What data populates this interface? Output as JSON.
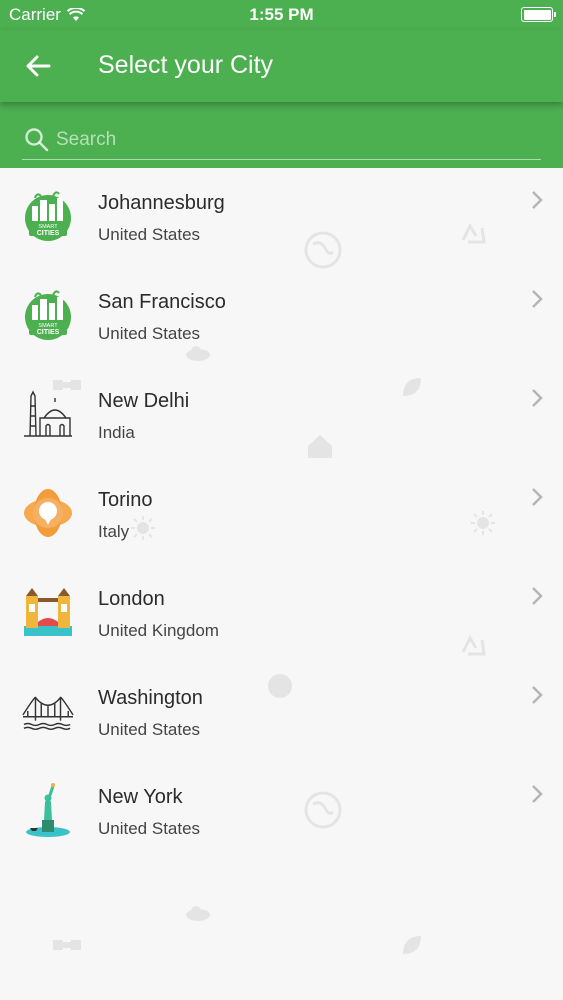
{
  "status": {
    "carrier": "Carrier",
    "time": "1:55 PM",
    "battery_level": 1.0
  },
  "header": {
    "title": "Select your City",
    "back_icon": "arrow-left-icon"
  },
  "search": {
    "placeholder": "Search",
    "value": ""
  },
  "cities": [
    {
      "name": "Johannesburg",
      "country": "United States",
      "icon": "smart-cities-badge-icon"
    },
    {
      "name": "San Francisco",
      "country": "United States",
      "icon": "smart-cities-badge-icon"
    },
    {
      "name": "New Delhi",
      "country": "India",
      "icon": "qutub-minar-icon"
    },
    {
      "name": "Torino",
      "country": "Italy",
      "icon": "torino-logo-icon"
    },
    {
      "name": "London",
      "country": "United Kingdom",
      "icon": "tower-bridge-icon"
    },
    {
      "name": "Washington",
      "country": "United States",
      "icon": "suspension-bridge-icon"
    },
    {
      "name": "New York",
      "country": "United States",
      "icon": "statue-of-liberty-icon"
    }
  ],
  "badge_text": {
    "line1": "SMART",
    "line2": "CITIES"
  },
  "colors": {
    "primary": "#4caf50",
    "background": "#f7f7f7",
    "torino": "#f39c3c"
  }
}
